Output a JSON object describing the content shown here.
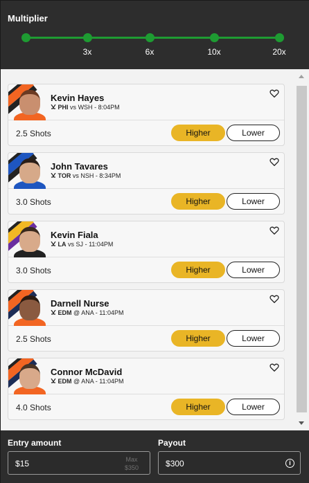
{
  "multiplier": {
    "title": "Multiplier",
    "steps": [
      "",
      "3x",
      "6x",
      "10x",
      "20x"
    ],
    "accent": "#1e9b32"
  },
  "players": [
    {
      "name": "Kevin Hayes",
      "team": "PHI",
      "sep": "vs",
      "opp": "WSH",
      "time": "8:04PM",
      "stat": "2.5 Shots",
      "colors": [
        "#f26522",
        "#222222"
      ],
      "jersey": "#f26522",
      "skin": "#c98f6f",
      "hair": "#6b3a22"
    },
    {
      "name": "John Tavares",
      "team": "TOR",
      "sep": "vs",
      "opp": "NSH",
      "time": "8:34PM",
      "stat": "3.0 Shots",
      "colors": [
        "#1e56c0",
        "#222222"
      ],
      "jersey": "#1e56c0",
      "skin": "#d6a989",
      "hair": "#2a1e18"
    },
    {
      "name": "Kevin Fiala",
      "team": "LA",
      "sep": "vs",
      "opp": "SJ",
      "time": "11:04PM",
      "stat": "3.0 Shots",
      "colors": [
        "#f2b824",
        "#6b2fa0"
      ],
      "jersey": "#222222",
      "skin": "#d8aa8a",
      "hair": "#3a2a1e"
    },
    {
      "name": "Darnell Nurse",
      "team": "EDM",
      "sep": "@",
      "opp": "ANA",
      "time": "11:04PM",
      "stat": "2.5 Shots",
      "colors": [
        "#f26522",
        "#1c2d57"
      ],
      "jersey": "#f26522",
      "skin": "#8a5a40",
      "hair": "#2a1a10"
    },
    {
      "name": "Connor McDavid",
      "team": "EDM",
      "sep": "@",
      "opp": "ANA",
      "time": "11:04PM",
      "stat": "4.0 Shots",
      "colors": [
        "#f26522",
        "#1c2d57"
      ],
      "jersey": "#f26522",
      "skin": "#d8a98a",
      "hair": "#4a3424"
    }
  ],
  "buttons": {
    "higher": "Higher",
    "lower": "Lower"
  },
  "footer": {
    "entry_label": "Entry amount",
    "entry_currency": "$",
    "entry_value": "15",
    "max_label": "Max",
    "max_value": "$350",
    "payout_label": "Payout",
    "payout_currency": "$",
    "payout_value": "300",
    "info_icon": "i"
  },
  "icons": {
    "heart": "heart-icon",
    "hockey": "hockey-sticks-icon",
    "info": "info-icon"
  }
}
